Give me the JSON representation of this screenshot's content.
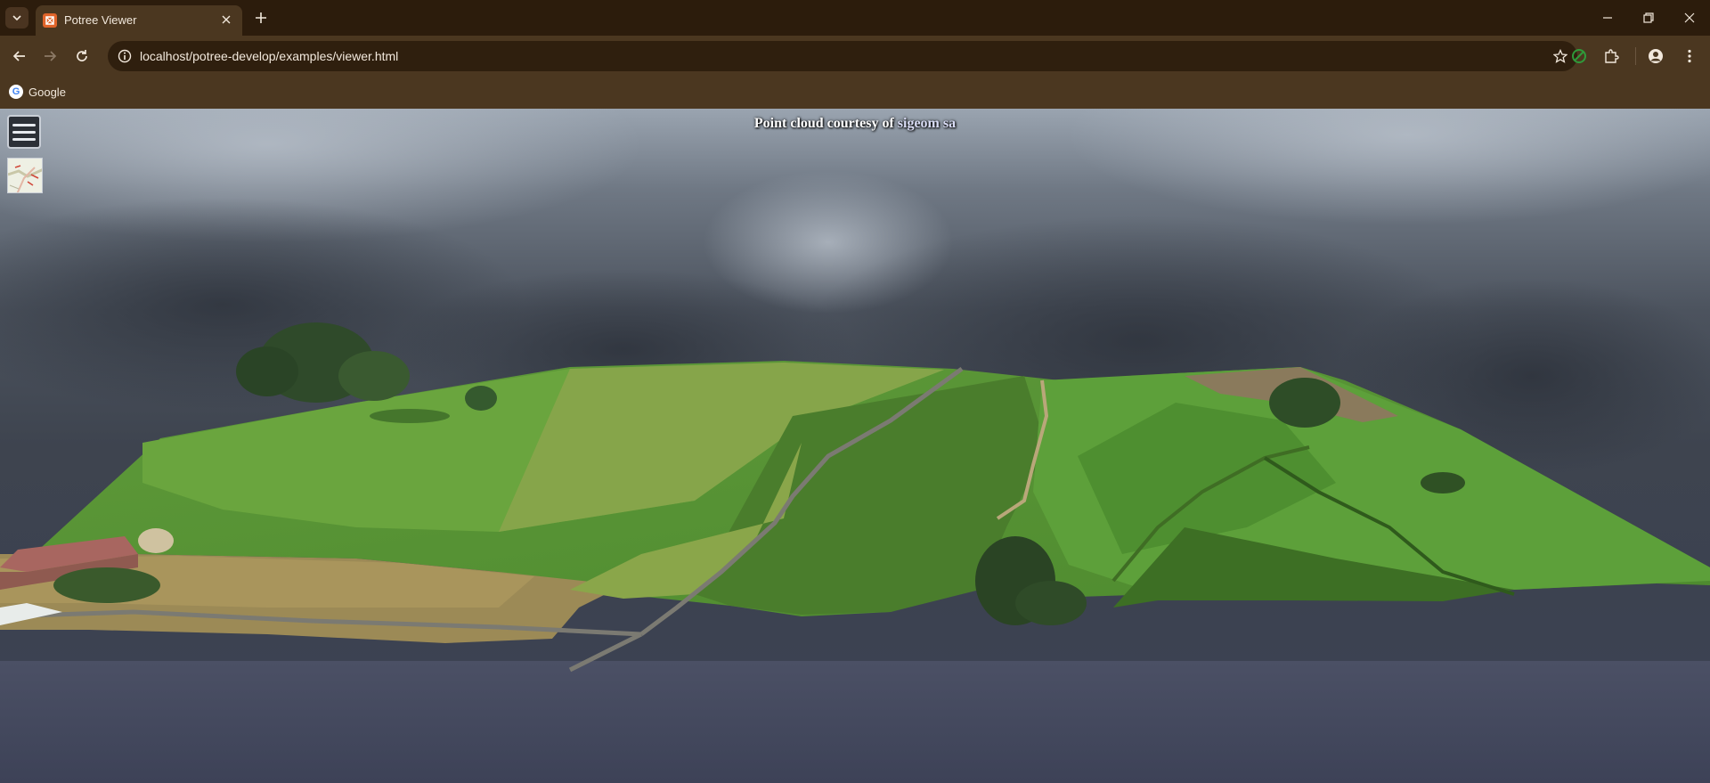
{
  "browser": {
    "tab_title": "Potree Viewer",
    "url": "localhost/potree-develop/examples/viewer.html",
    "bookmarks": [
      {
        "label": "Google"
      }
    ],
    "icons": {
      "tab_list": "chevron-down-icon",
      "tab_favicon": "potree-favicon-icon",
      "tab_close": "close-icon",
      "new_tab": "plus-icon",
      "back": "arrow-left-icon",
      "forward": "arrow-right-icon",
      "reload": "reload-icon",
      "site_info": "info-icon",
      "bookmark": "star-icon",
      "extension": "puzzle-icon",
      "profile": "profile-icon",
      "menu": "kebab-menu-icon"
    },
    "colors": {
      "frame": "#2c1c0c",
      "toolbar": "#4b3720",
      "omnibox": "#2f1f0e",
      "favicon": "#e0642a"
    }
  },
  "viewer": {
    "attribution_prefix": "Point cloud courtesy of ",
    "attribution_link": "sigeom sa",
    "icons": {
      "menu_toggle": "hamburger-menu-icon",
      "map_toggle": "map-thumbnail-icon"
    }
  }
}
